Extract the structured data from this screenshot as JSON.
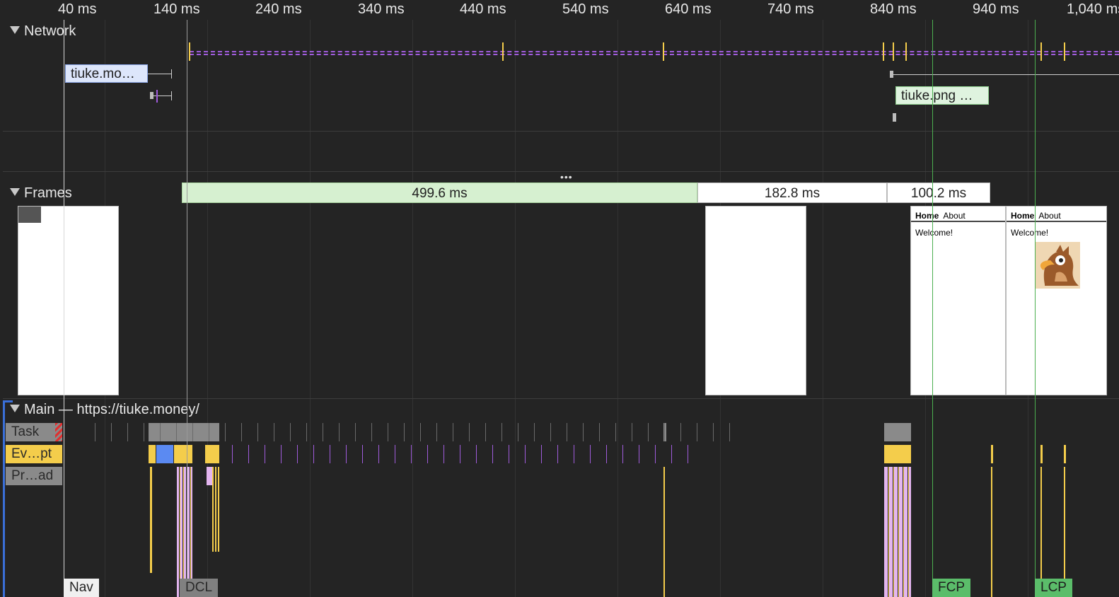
{
  "ruler": {
    "ticks": [
      "40 ms",
      "140 ms",
      "240 ms",
      "340 ms",
      "440 ms",
      "540 ms",
      "640 ms",
      "740 ms",
      "840 ms",
      "940 ms",
      "1,040 ms"
    ]
  },
  "network": {
    "title": "Network",
    "requests": [
      {
        "label": "tiuke.mo…",
        "color": "#dde6fb"
      },
      {
        "label": "tiuke.png …",
        "color": "#dff3df"
      }
    ],
    "request_line_color": "#a05cdc"
  },
  "frames": {
    "title": "Frames",
    "durations": [
      "499.6 ms",
      "182.8 ms",
      "100.2 ms"
    ],
    "thumbnail": {
      "nav_home": "Home",
      "nav_about": "About",
      "welcome": "Welcome!",
      "image_icon": "eagle-mascot-icon"
    },
    "long_frame_color": "#d6f0d0"
  },
  "main": {
    "title": "Main — https://tiuke.money/",
    "tracks": [
      {
        "label": "Task",
        "color": "#8a8a8a"
      },
      {
        "label": "Ev…pt",
        "color": "#f4cd4b"
      },
      {
        "label": "Pr…ad",
        "color": "#8a8a8a"
      }
    ]
  },
  "markers": [
    {
      "label": "Nav",
      "color": "#f0f0f0"
    },
    {
      "label": "DCL",
      "color": "#808080"
    },
    {
      "label": "FCP",
      "color": "#5bbd6a"
    },
    {
      "label": "LCP",
      "color": "#5bbd6a"
    }
  ],
  "colors": {
    "scripting": "#f4cd4b",
    "rendering": "#e3b5ef",
    "painting": "#5b8af2",
    "task": "#8a8a8a",
    "lcp_line": "#4caf50"
  }
}
